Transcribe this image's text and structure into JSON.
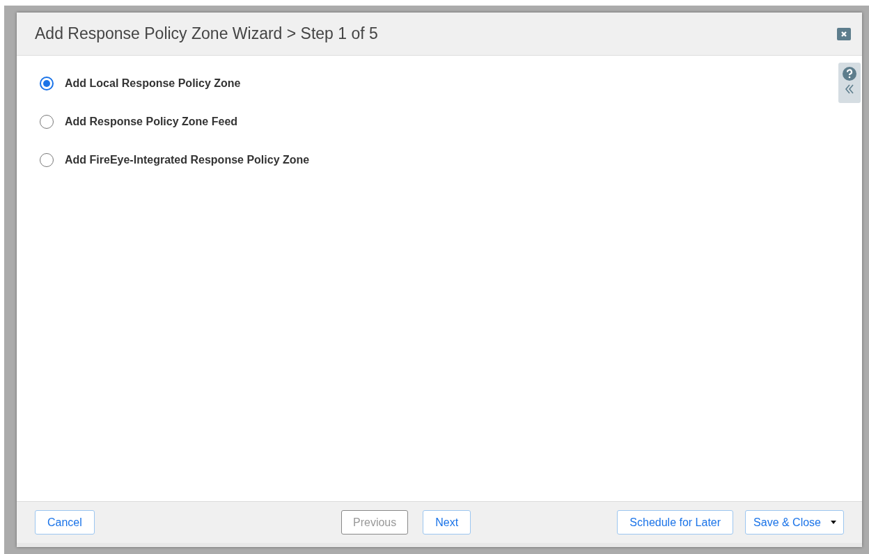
{
  "dialog": {
    "title": "Add Response Policy Zone Wizard > Step 1 of 5"
  },
  "options": [
    {
      "label": "Add Local Response Policy Zone",
      "selected": true
    },
    {
      "label": "Add Response Policy Zone Feed",
      "selected": false
    },
    {
      "label": "Add FireEye-Integrated Response Policy Zone",
      "selected": false
    }
  ],
  "footer": {
    "left": [
      {
        "label": "Cancel",
        "disabled": false
      }
    ],
    "center": [
      {
        "label": "Previous",
        "disabled": true
      },
      {
        "label": "Next",
        "disabled": false
      }
    ],
    "right": [
      {
        "label": "Schedule for Later",
        "disabled": false,
        "kind": "plain"
      },
      {
        "label": "Save & Close",
        "disabled": false,
        "kind": "split"
      }
    ]
  }
}
